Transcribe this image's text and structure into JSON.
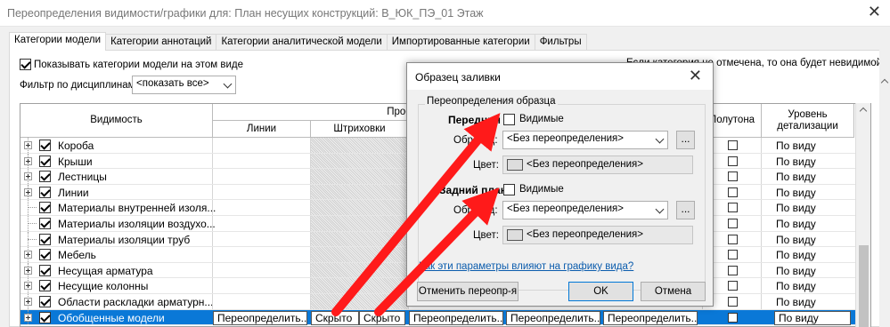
{
  "window": {
    "title": "Переопределения видимости/графики для: План несущих конструкций: В_ЮК_ПЭ_01 Этаж",
    "close": "✕"
  },
  "tabs": [
    "Категории модели",
    "Категории аннотаций",
    "Категории аналитической модели",
    "Импортированные категории",
    "Фильтры"
  ],
  "show_categories_label": "Показывать категории модели на этом виде",
  "filter": {
    "label": "Фильтр по дисциплинам:",
    "value": "<показать все>"
  },
  "note": "Если категория не отмечена, то она будет невидимой.",
  "grid": {
    "headers": {
      "visibility": "Видимость",
      "projection_surface": "Проекция/Поверхность",
      "lines": "Линии",
      "patterns": "Штриховки",
      "halftone": "Полутона",
      "detail_level": "Уровень детализации"
    },
    "rows": [
      {
        "name": "Короба",
        "level": "По виду",
        "expandable": true
      },
      {
        "name": "Крыши",
        "level": "По виду",
        "expandable": true
      },
      {
        "name": "Лестницы",
        "level": "По виду",
        "expandable": true
      },
      {
        "name": "Линии",
        "level": "По виду",
        "expandable": true
      },
      {
        "name": "Материалы внутренней изоля...",
        "level": "По виду",
        "expandable": false
      },
      {
        "name": "Материалы изоляции воздухо...",
        "level": "По виду",
        "expandable": false
      },
      {
        "name": "Материалы изоляции труб",
        "level": "По виду",
        "expandable": false
      },
      {
        "name": "Мебель",
        "level": "По виду",
        "expandable": true
      },
      {
        "name": "Несущая арматура",
        "level": "По виду",
        "expandable": true
      },
      {
        "name": "Несущие колонны",
        "level": "По виду",
        "expandable": true
      },
      {
        "name": "Области раскладки арматурн...",
        "level": "По виду",
        "expandable": true
      },
      {
        "name": "Обобщенные модели",
        "level": "По виду",
        "expandable": true,
        "selected": true
      }
    ],
    "selected_row": {
      "lines_override": "Переопределить...",
      "hidden_1": "Скрыто",
      "hidden_2": "Скрыто",
      "override_3": "Переопределить...",
      "override_4": "Переопределить...",
      "override_5": "Переопределить..."
    }
  },
  "dialog": {
    "title": "Образец заливки",
    "close": "✕",
    "group": "Переопределения образца",
    "foreground": {
      "label": "Передний",
      "visible": "Видимые",
      "pattern_label": "Образец:",
      "pattern_value": "<Без переопределения>",
      "color_label": "Цвет:",
      "color_value": "<Без переопределения>"
    },
    "background": {
      "label": "Задний план",
      "visible": "Видимые",
      "pattern_label": "Образец:",
      "pattern_value": "<Без переопределения>",
      "color_label": "Цвет:",
      "color_value": "<Без переопределения>"
    },
    "dots": "...",
    "link": "Как эти параметры влияют на графику вида?",
    "buttons": {
      "reset": "Отменить переопр-я",
      "ok": "OK",
      "cancel": "Отмена"
    }
  },
  "colors": {
    "selection": "#0a78d7",
    "arrow": "#ff1a1a",
    "link": "#0b5cad"
  }
}
